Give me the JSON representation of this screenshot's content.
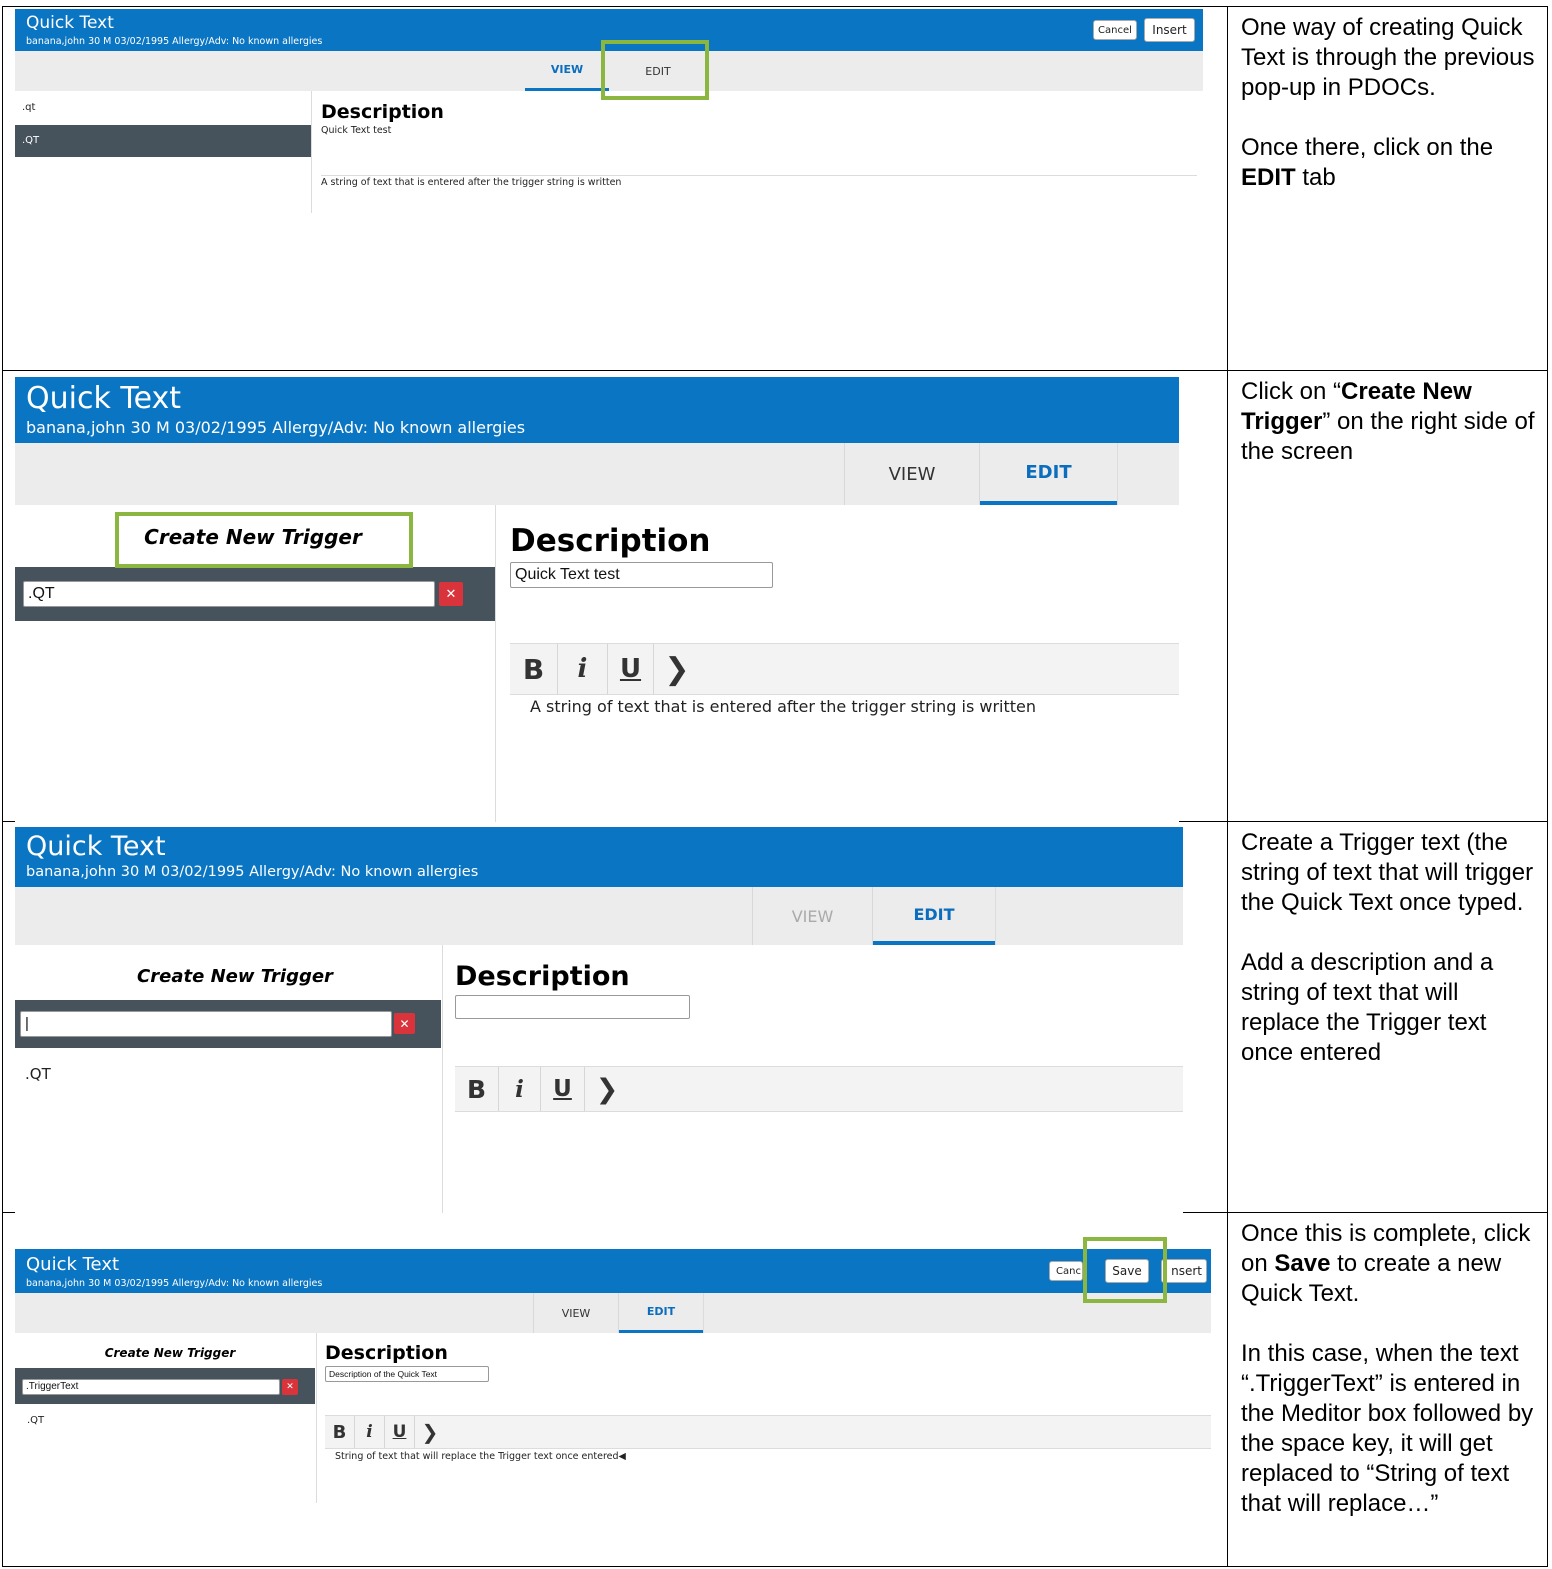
{
  "app": {
    "title": "Quick Text",
    "patient": "banana,john  30  M  03/02/1995    Allergy/Adv: No known allergies"
  },
  "tabs": {
    "view": "VIEW",
    "edit": "EDIT"
  },
  "buttons": {
    "cancel": "Cancel",
    "insert": "Insert",
    "save": "Save"
  },
  "step1": {
    "list": [
      ".qt",
      ".QT"
    ],
    "description_heading": "Description",
    "description_value": "Quick Text test",
    "body_text": "A string of text that is entered after the trigger string is written",
    "note": {
      "p1": "One way of creating Quick Text is through the previous pop-up in PDOCs.",
      "p2_pre": "Once there, click on the ",
      "p2_bold": "EDIT",
      "p2_post": " tab"
    }
  },
  "step2": {
    "create_trigger": "Create New Trigger",
    "trigger_value": ".QT",
    "description_heading": "Description",
    "description_value": "Quick Text test",
    "body_text": "A string of text that is entered after the trigger string is written",
    "note": {
      "pre": "Click on “",
      "bold": "Create New Trigger",
      "post": "” on the right side of the screen"
    }
  },
  "step3": {
    "create_trigger": "Create New Trigger",
    "trigger_value": "|",
    "list": [
      ".QT"
    ],
    "description_heading": "Description",
    "description_value": "",
    "note": {
      "p1": "Create a Trigger text (the string of text that will trigger the Quick Text once typed.",
      "p2": "Add a description and a string of text that will replace the Trigger text once entered"
    }
  },
  "step4": {
    "create_trigger": "Create New Trigger",
    "trigger_value": ".TriggerText",
    "list": [
      ".QT"
    ],
    "description_heading": "Description",
    "description_value": "Description of the Quick Text",
    "body_text": "String of text that will replace the Trigger text once entered◀",
    "cancel_partial": "Canc",
    "insert_partial": "nsert",
    "note": {
      "p1_pre": "Once this is complete, click on ",
      "p1_bold": "Save",
      "p1_post": " to create a new Quick Text.",
      "p2": "In this case, when the text “.TriggerText” is entered in the Meditor box followed by the space key, it will get replaced to “String of text that will replace…”"
    }
  },
  "toolbar": {
    "bold": "B",
    "italic": "i",
    "underline": "U",
    "more": "❯"
  },
  "colors": {
    "header": "#0a75c2",
    "selected": "#46525c",
    "highlight": "#8bb640",
    "delete": "#d9343b"
  }
}
